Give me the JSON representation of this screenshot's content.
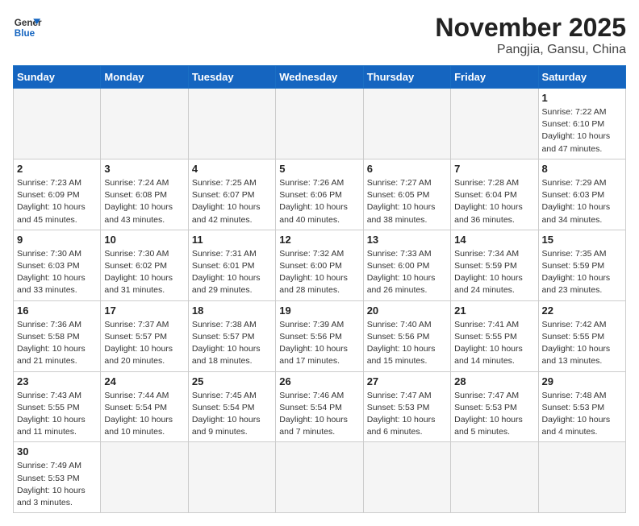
{
  "logo": {
    "line1": "General",
    "line2": "Blue"
  },
  "title": "November 2025",
  "subtitle": "Pangjia, Gansu, China",
  "weekdays": [
    "Sunday",
    "Monday",
    "Tuesday",
    "Wednesday",
    "Thursday",
    "Friday",
    "Saturday"
  ],
  "weeks": [
    [
      {
        "day": "",
        "info": ""
      },
      {
        "day": "",
        "info": ""
      },
      {
        "day": "",
        "info": ""
      },
      {
        "day": "",
        "info": ""
      },
      {
        "day": "",
        "info": ""
      },
      {
        "day": "",
        "info": ""
      },
      {
        "day": "1",
        "info": "Sunrise: 7:22 AM\nSunset: 6:10 PM\nDaylight: 10 hours\nand 47 minutes."
      }
    ],
    [
      {
        "day": "2",
        "info": "Sunrise: 7:23 AM\nSunset: 6:09 PM\nDaylight: 10 hours\nand 45 minutes."
      },
      {
        "day": "3",
        "info": "Sunrise: 7:24 AM\nSunset: 6:08 PM\nDaylight: 10 hours\nand 43 minutes."
      },
      {
        "day": "4",
        "info": "Sunrise: 7:25 AM\nSunset: 6:07 PM\nDaylight: 10 hours\nand 42 minutes."
      },
      {
        "day": "5",
        "info": "Sunrise: 7:26 AM\nSunset: 6:06 PM\nDaylight: 10 hours\nand 40 minutes."
      },
      {
        "day": "6",
        "info": "Sunrise: 7:27 AM\nSunset: 6:05 PM\nDaylight: 10 hours\nand 38 minutes."
      },
      {
        "day": "7",
        "info": "Sunrise: 7:28 AM\nSunset: 6:04 PM\nDaylight: 10 hours\nand 36 minutes."
      },
      {
        "day": "8",
        "info": "Sunrise: 7:29 AM\nSunset: 6:03 PM\nDaylight: 10 hours\nand 34 minutes."
      }
    ],
    [
      {
        "day": "9",
        "info": "Sunrise: 7:30 AM\nSunset: 6:03 PM\nDaylight: 10 hours\nand 33 minutes."
      },
      {
        "day": "10",
        "info": "Sunrise: 7:30 AM\nSunset: 6:02 PM\nDaylight: 10 hours\nand 31 minutes."
      },
      {
        "day": "11",
        "info": "Sunrise: 7:31 AM\nSunset: 6:01 PM\nDaylight: 10 hours\nand 29 minutes."
      },
      {
        "day": "12",
        "info": "Sunrise: 7:32 AM\nSunset: 6:00 PM\nDaylight: 10 hours\nand 28 minutes."
      },
      {
        "day": "13",
        "info": "Sunrise: 7:33 AM\nSunset: 6:00 PM\nDaylight: 10 hours\nand 26 minutes."
      },
      {
        "day": "14",
        "info": "Sunrise: 7:34 AM\nSunset: 5:59 PM\nDaylight: 10 hours\nand 24 minutes."
      },
      {
        "day": "15",
        "info": "Sunrise: 7:35 AM\nSunset: 5:59 PM\nDaylight: 10 hours\nand 23 minutes."
      }
    ],
    [
      {
        "day": "16",
        "info": "Sunrise: 7:36 AM\nSunset: 5:58 PM\nDaylight: 10 hours\nand 21 minutes."
      },
      {
        "day": "17",
        "info": "Sunrise: 7:37 AM\nSunset: 5:57 PM\nDaylight: 10 hours\nand 20 minutes."
      },
      {
        "day": "18",
        "info": "Sunrise: 7:38 AM\nSunset: 5:57 PM\nDaylight: 10 hours\nand 18 minutes."
      },
      {
        "day": "19",
        "info": "Sunrise: 7:39 AM\nSunset: 5:56 PM\nDaylight: 10 hours\nand 17 minutes."
      },
      {
        "day": "20",
        "info": "Sunrise: 7:40 AM\nSunset: 5:56 PM\nDaylight: 10 hours\nand 15 minutes."
      },
      {
        "day": "21",
        "info": "Sunrise: 7:41 AM\nSunset: 5:55 PM\nDaylight: 10 hours\nand 14 minutes."
      },
      {
        "day": "22",
        "info": "Sunrise: 7:42 AM\nSunset: 5:55 PM\nDaylight: 10 hours\nand 13 minutes."
      }
    ],
    [
      {
        "day": "23",
        "info": "Sunrise: 7:43 AM\nSunset: 5:55 PM\nDaylight: 10 hours\nand 11 minutes."
      },
      {
        "day": "24",
        "info": "Sunrise: 7:44 AM\nSunset: 5:54 PM\nDaylight: 10 hours\nand 10 minutes."
      },
      {
        "day": "25",
        "info": "Sunrise: 7:45 AM\nSunset: 5:54 PM\nDaylight: 10 hours\nand 9 minutes."
      },
      {
        "day": "26",
        "info": "Sunrise: 7:46 AM\nSunset: 5:54 PM\nDaylight: 10 hours\nand 7 minutes."
      },
      {
        "day": "27",
        "info": "Sunrise: 7:47 AM\nSunset: 5:53 PM\nDaylight: 10 hours\nand 6 minutes."
      },
      {
        "day": "28",
        "info": "Sunrise: 7:47 AM\nSunset: 5:53 PM\nDaylight: 10 hours\nand 5 minutes."
      },
      {
        "day": "29",
        "info": "Sunrise: 7:48 AM\nSunset: 5:53 PM\nDaylight: 10 hours\nand 4 minutes."
      }
    ],
    [
      {
        "day": "30",
        "info": "Sunrise: 7:49 AM\nSunset: 5:53 PM\nDaylight: 10 hours\nand 3 minutes."
      },
      {
        "day": "",
        "info": ""
      },
      {
        "day": "",
        "info": ""
      },
      {
        "day": "",
        "info": ""
      },
      {
        "day": "",
        "info": ""
      },
      {
        "day": "",
        "info": ""
      },
      {
        "day": "",
        "info": ""
      }
    ]
  ]
}
